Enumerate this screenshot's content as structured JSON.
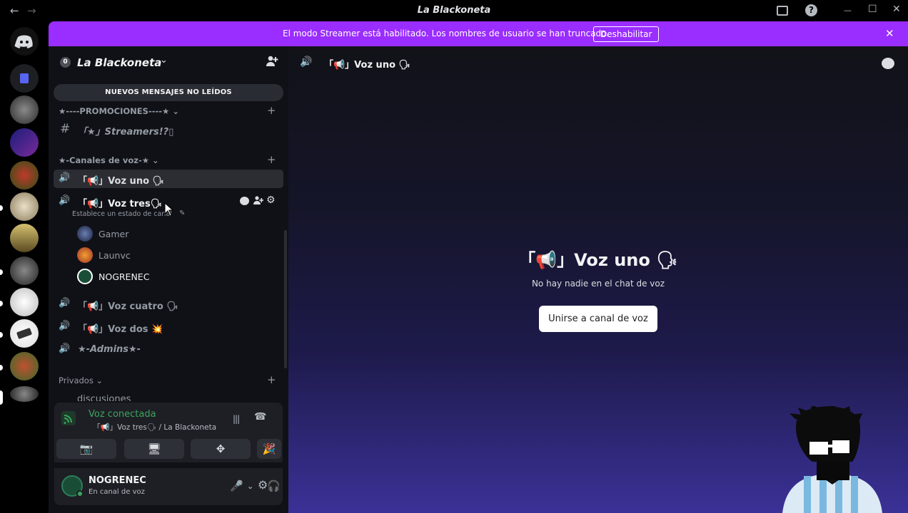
{
  "window": {
    "title": "La Blackoneta",
    "back_icon": "←",
    "forward_icon": "→",
    "help_icon": "?",
    "minimize_icon": "—",
    "maximize_icon": "☐",
    "close_icon": "✕"
  },
  "banner": {
    "text": "El modo Streamer está habilitado. Los nombres de usuario se han truncado.",
    "button_label": "Deshabilitar",
    "close_icon": "✕",
    "color": "#9a2dff"
  },
  "guild": {
    "name": "La Blackoneta",
    "badge": "0",
    "chevron": "⌄",
    "invite_icon": "👤+"
  },
  "sidebar": {
    "new_messages": "NUEVOS MENSAJES NO LEÍDOS",
    "categories": {
      "promociones": "★----PROMOCIONES----★ ⌄",
      "voz": "★-Canales de voz-★ ⌄",
      "privados": "Privados ⌄"
    },
    "plus": "+",
    "channels": {
      "streamers": "「★」Streamers!?▯",
      "voz_uno": "「📢」Voz uno 🗣",
      "voz_tres": "「📢」Voz tres🗣",
      "voz_tres_status": "Establece un estado de canal",
      "voz_cuatro": "「📢」Voz cuatro 🗣",
      "voz_dos": "「📢」Voz dos 💥",
      "admins": "★-Admins★-",
      "discusiones": "discusiones"
    },
    "icons": {
      "hash": "#",
      "speaker": "🔊",
      "edit": "✎",
      "chat": "💬",
      "add_user": "👤",
      "gear": "⚙"
    },
    "users": [
      "Gamer",
      "Launvc",
      "NOGRENEC"
    ]
  },
  "voice_panel": {
    "status": "Voz conectada",
    "channel": "「📢」Voz tres🗣 / La Blackoneta",
    "status_color": "#3ba55c",
    "buttons": {
      "camera": "📷",
      "screen": "🖥",
      "activities": "✥",
      "soundboard": "🎉"
    },
    "wave_icon": "|||",
    "disconnect_icon": "☎"
  },
  "user_panel": {
    "name": "NOGRENEC",
    "status": "En canal de voz",
    "mic_icon": "🎤",
    "headset_icon": "🎧",
    "chevron": "⌄",
    "gear_icon": "⚙"
  },
  "main": {
    "channel_name": "「📢」Voz uno 🗣",
    "center_title": "「📢」Voz uno 🗣",
    "center_subtitle": "No hay nadie en el chat de voz",
    "join_button": "Unirse a canal de voz",
    "speaker_icon": "🔊",
    "chat_icon": "💬"
  }
}
